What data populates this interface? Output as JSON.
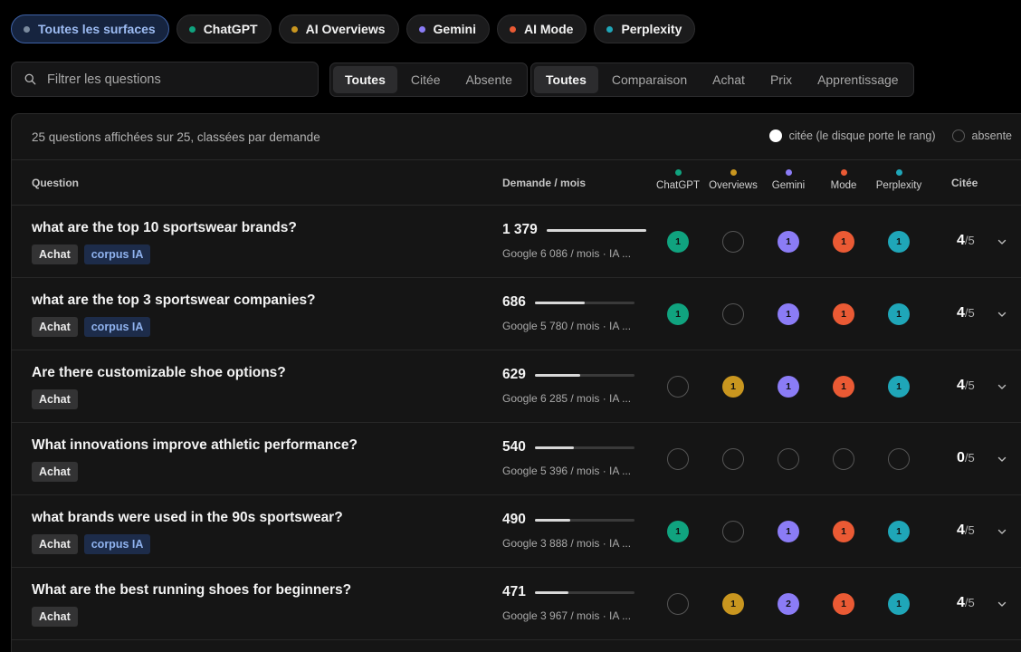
{
  "surfaces": [
    {
      "label": "Toutes les surfaces",
      "color": "#7a8a9e",
      "active": true
    },
    {
      "label": "ChatGPT",
      "color": "#10a37f",
      "active": false
    },
    {
      "label": "AI Overviews",
      "color": "#c9961f",
      "active": false
    },
    {
      "label": "Gemini",
      "color": "#8b7cf6",
      "active": false
    },
    {
      "label": "AI Mode",
      "color": "#ea5a34",
      "active": false
    },
    {
      "label": "Perplexity",
      "color": "#1fa6b8",
      "active": false
    }
  ],
  "search": {
    "placeholder": "Filtrer les questions",
    "value": ""
  },
  "citation_filter": [
    "Toutes",
    "Citée",
    "Absente"
  ],
  "intent_filter": [
    "Toutes",
    "Comparaison",
    "Achat",
    "Prix",
    "Apprentissage"
  ],
  "summary": "25 questions affichées sur 25, classées par demande",
  "legend": {
    "cited": "citée (le disque porte le rang)",
    "absent": "absente"
  },
  "columns": {
    "question": "Question",
    "demand": "Demande / mois",
    "cited": "Citée"
  },
  "surface_columns": [
    {
      "label": "ChatGPT",
      "color": "#10a37f"
    },
    {
      "label": "Overviews",
      "color": "#c9961f"
    },
    {
      "label": "Gemini",
      "color": "#8b7cf6"
    },
    {
      "label": "Mode",
      "color": "#ea5a34"
    },
    {
      "label": "Perplexity",
      "color": "#1fa6b8"
    }
  ],
  "score_total": "/5",
  "rows": [
    {
      "question": "what are the top 10 sportswear brands?",
      "tags": [
        "Achat",
        "corpus IA"
      ],
      "demand": "1 379",
      "demand_fraction": 1.0,
      "sub": "Google 6 086 / mois · IA ...",
      "ranks": [
        "1",
        "",
        "1",
        "1",
        "1"
      ],
      "score": "4"
    },
    {
      "question": "what are the top 3 sportswear companies?",
      "tags": [
        "Achat",
        "corpus IA"
      ],
      "demand": "686",
      "demand_fraction": 0.5,
      "sub": "Google 5 780 / mois · IA ...",
      "ranks": [
        "1",
        "",
        "1",
        "1",
        "1"
      ],
      "score": "4"
    },
    {
      "question": "Are there customizable shoe options?",
      "tags": [
        "Achat"
      ],
      "demand": "629",
      "demand_fraction": 0.46,
      "sub": "Google 6 285 / mois · IA ...",
      "ranks": [
        "",
        "1",
        "1",
        "1",
        "1"
      ],
      "score": "4"
    },
    {
      "question": "What innovations improve athletic performance?",
      "tags": [
        "Achat"
      ],
      "demand": "540",
      "demand_fraction": 0.39,
      "sub": "Google 5 396 / mois · IA ...",
      "ranks": [
        "",
        "",
        "",
        "",
        ""
      ],
      "score": "0"
    },
    {
      "question": "what brands were used in the 90s sportswear?",
      "tags": [
        "Achat",
        "corpus IA"
      ],
      "demand": "490",
      "demand_fraction": 0.36,
      "sub": "Google 3 888 / mois · IA ...",
      "ranks": [
        "1",
        "",
        "1",
        "1",
        "1"
      ],
      "score": "4"
    },
    {
      "question": "What are the best running shoes for beginners?",
      "tags": [
        "Achat"
      ],
      "demand": "471",
      "demand_fraction": 0.34,
      "sub": "Google 3 967 / mois · IA ...",
      "ranks": [
        "",
        "1",
        "2",
        "1",
        "1"
      ],
      "score": "4"
    }
  ]
}
